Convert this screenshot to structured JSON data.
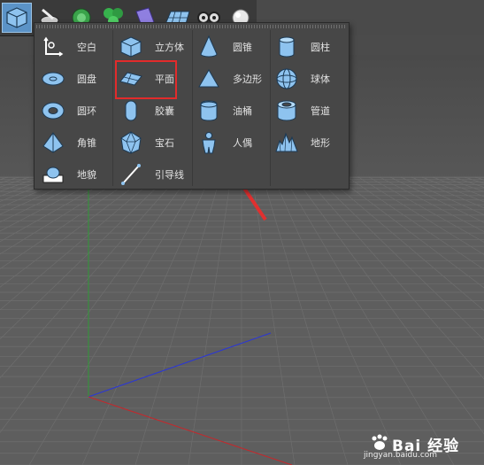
{
  "menu": {
    "columns": [
      [
        {
          "label": "空白",
          "icon": "null-object-icon"
        },
        {
          "label": "圆盘",
          "icon": "disc-icon"
        },
        {
          "label": "圆环",
          "icon": "torus-icon"
        },
        {
          "label": "角锥",
          "icon": "pyramid-icon"
        },
        {
          "label": "地貌",
          "icon": "landscape-icon"
        }
      ],
      [
        {
          "label": "立方体",
          "icon": "cube-icon"
        },
        {
          "label": "平面",
          "icon": "plane-icon"
        },
        {
          "label": "胶囊",
          "icon": "capsule-icon"
        },
        {
          "label": "宝石",
          "icon": "platonic-icon"
        },
        {
          "label": "引导线",
          "icon": "guide-icon"
        }
      ],
      [
        {
          "label": "圆锥",
          "icon": "cone-icon"
        },
        {
          "label": "多边形",
          "icon": "polygon-icon"
        },
        {
          "label": "油桶",
          "icon": "oil-tank-icon"
        },
        {
          "label": "人偶",
          "icon": "figure-icon"
        }
      ],
      [
        {
          "label": "圆柱",
          "icon": "cylinder-icon"
        },
        {
          "label": "球体",
          "icon": "sphere-icon"
        },
        {
          "label": "管道",
          "icon": "tube-icon"
        },
        {
          "label": "地形",
          "icon": "relief-icon"
        }
      ]
    ]
  },
  "toolbar": {
    "icons": [
      "cube-icon",
      "pen-icon",
      "subdivision-icon",
      "cloner-icon",
      "deformer-icon",
      "floor-icon",
      "camera-icon",
      "light-icon"
    ]
  },
  "watermark": {
    "brand": "Bai 经验",
    "url": "jingyan.baidu.com"
  },
  "colors": {
    "accent": "#5b93c7",
    "icon_blue": "#8ec3ef",
    "highlight": "#e22b2b",
    "arrow": "#e0302f"
  }
}
